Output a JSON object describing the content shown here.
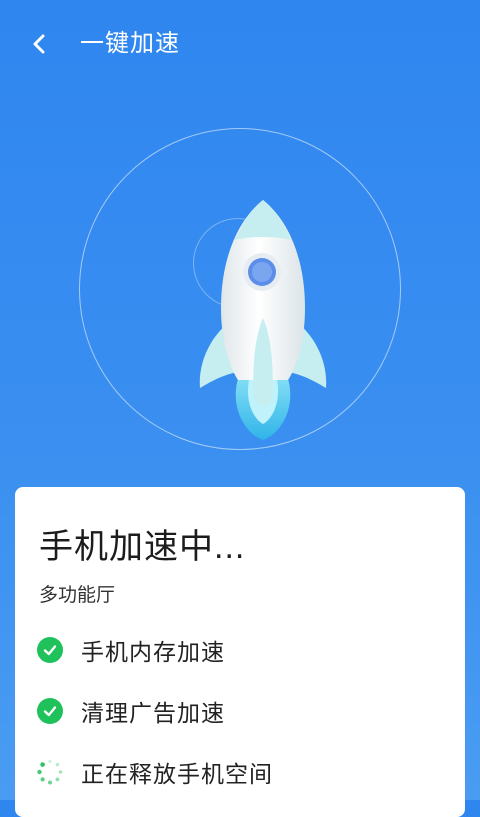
{
  "header": {
    "title": "一键加速",
    "back_icon": "chevron-left-icon"
  },
  "hero": {
    "illustration": "rocket-icon",
    "colors": {
      "rocket_body": "#f1f4f6",
      "rocket_fin": "#c6eef0",
      "window": "#5b8ee9",
      "flame": "#5fd2ef"
    }
  },
  "card": {
    "title": "手机加速中...",
    "subtitle": "多功能厅",
    "tasks": [
      {
        "label": "手机内存加速",
        "status": "done",
        "icon": "check-circle-icon"
      },
      {
        "label": "清理广告加速",
        "status": "done",
        "icon": "check-circle-icon"
      },
      {
        "label": "正在释放手机空间",
        "status": "in-progress",
        "icon": "loading-spinner-icon"
      }
    ]
  },
  "colors": {
    "background_top": "#2f86ef",
    "background_bottom": "#4a9cf2",
    "success": "#1fc15b",
    "spinner": "#2ec466"
  }
}
